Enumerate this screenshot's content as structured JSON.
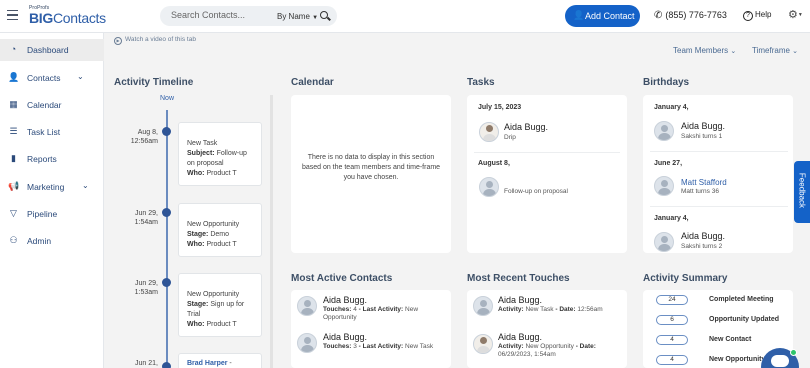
{
  "app": {
    "logo_top": "ProProfs",
    "logo_main": "BIGContacts",
    "logo_a": "BIG",
    "logo_b": "Contacts"
  },
  "header": {
    "search_placeholder": "Search Contacts...",
    "search_mode": "By Name",
    "add_contact": "Add Contact",
    "phone": "(855) 776-7763",
    "help": "Help"
  },
  "sidebar": {
    "items": [
      {
        "label": "Dashboard",
        "icon": "dashboard-icon"
      },
      {
        "label": "Contacts",
        "icon": "person-icon"
      },
      {
        "label": "Calendar",
        "icon": "calendar-icon"
      },
      {
        "label": "Task List",
        "icon": "task-list-icon"
      },
      {
        "label": "Reports",
        "icon": "bar-chart-icon"
      },
      {
        "label": "Marketing",
        "icon": "megaphone-icon"
      },
      {
        "label": "Pipeline",
        "icon": "funnel-icon"
      },
      {
        "label": "Admin",
        "icon": "admin-icon"
      }
    ]
  },
  "toolbar": {
    "video_link": "Watch a video of this tab",
    "team_members": "Team Members",
    "timeframe": "Timeframe"
  },
  "activity_timeline": {
    "title": "Activity Timeline",
    "now": "Now",
    "entries": [
      {
        "date": "Aug 8,",
        "time": "12:56am",
        "type": "New Task",
        "l1_key": "Subject:",
        "l1_val": "Follow-up on proposal",
        "l2_key": "Who:",
        "l2_val": "Product T"
      },
      {
        "date": "Jun 29,",
        "time": "1:54am",
        "type": "New Opportunity",
        "l1_key": "Stage:",
        "l1_val": "Demo",
        "l2_key": "Who:",
        "l2_val": "Product T"
      },
      {
        "date": "Jun 29,",
        "time": "1:53am",
        "type": "New Opportunity",
        "l1_key": "Stage:",
        "l1_val": "Sign up for Trial",
        "l2_key": "Who:",
        "l2_val": "Product T"
      },
      {
        "date": "Jun 21,",
        "name": "Brad Harper"
      }
    ]
  },
  "calendar": {
    "title": "Calendar",
    "empty": "There is no data to display in this section based on the team members and time-frame you have chosen."
  },
  "tasks": {
    "title": "Tasks",
    "groups": [
      {
        "date": "July 15, 2023",
        "name": "Aida Bugg.",
        "desc": "Drip"
      },
      {
        "date": "August 8,",
        "desc": "Follow-up on proposal"
      }
    ]
  },
  "birthdays": {
    "title": "Birthdays",
    "groups": [
      {
        "date": "January 4,",
        "name": "Aida Bugg.",
        "note": "Sakshi turns 1"
      },
      {
        "date": "June 27,",
        "name": "Matt Stafford",
        "note": "Matt turns 36"
      },
      {
        "date": "January 4,",
        "name": "Aida Bugg.",
        "note": "Sakshi turns 2"
      }
    ]
  },
  "most_active": {
    "title": "Most Active Contacts",
    "items": [
      {
        "name": "Aida Bugg.",
        "touches_label": "Touches:",
        "touches": "4",
        "activity_label": "- Last Activity:",
        "activity": "New Opportunity"
      },
      {
        "name": "Aida Bugg.",
        "touches_label": "Touches:",
        "touches": "3",
        "activity_label": "- Last Activity:",
        "activity": "New Task"
      }
    ]
  },
  "recent_touches": {
    "title": "Most Recent Touches",
    "items": [
      {
        "name": "Aida Bugg.",
        "activity_label": "Activity:",
        "activity": "New Task",
        "date_label": "- Date:",
        "date": "12:56am"
      },
      {
        "name": "Aida Bugg.",
        "activity_label": "Activity:",
        "activity": "New Opportunity",
        "date_label": "- Date:",
        "date": "06/29/2023, 1:54am"
      }
    ]
  },
  "activity_summary": {
    "title": "Activity Summary",
    "items": [
      {
        "count": "24",
        "label": "Completed Meeting"
      },
      {
        "count": "6",
        "label": "Opportunity Updated"
      },
      {
        "count": "4",
        "label": "New Contact"
      },
      {
        "count": "4",
        "label": "New Opportunity"
      }
    ]
  },
  "feedback": "Feedback"
}
